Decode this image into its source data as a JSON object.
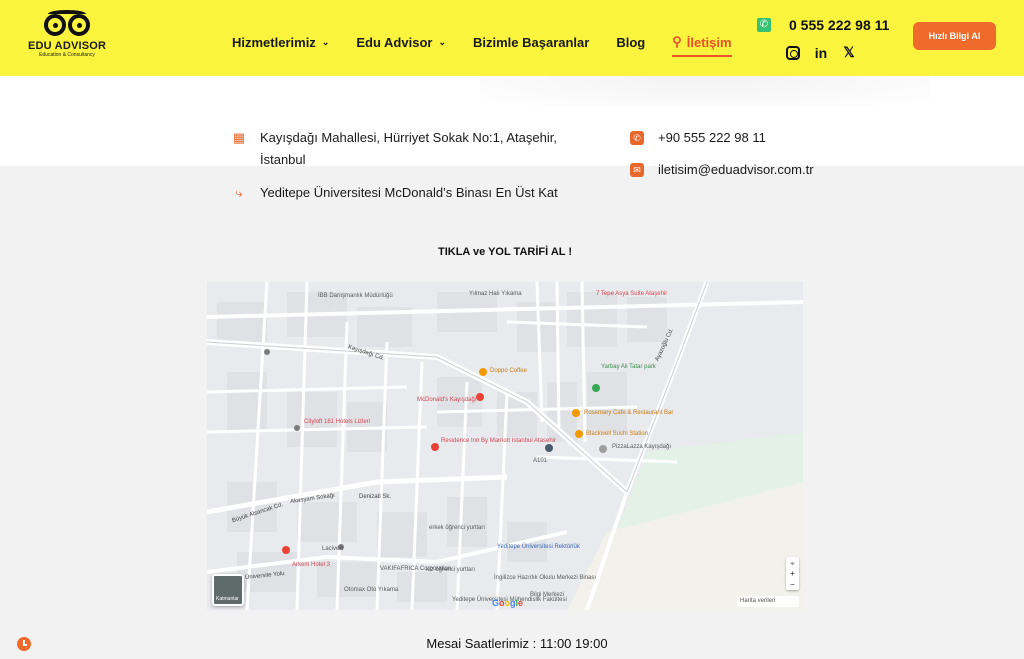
{
  "brand": {
    "name": "EDU ADVISOR",
    "tagline": "Education & Consultancy"
  },
  "nav": {
    "items": [
      {
        "label": "Hizmetlerimiz",
        "dropdown": true
      },
      {
        "label": "Edu Advisor",
        "dropdown": true
      },
      {
        "label": "Bizimle Başaranlar",
        "dropdown": false
      },
      {
        "label": "Blog",
        "dropdown": false
      },
      {
        "label": "İletişim",
        "dropdown": false,
        "active": true
      }
    ]
  },
  "header": {
    "phone": "0 555 222 98 11",
    "quick_button": "Hızlı Bilgi Al",
    "social": [
      "instagram-icon",
      "linkedin-icon",
      "x-icon"
    ]
  },
  "contact": {
    "address_line1": "Kayışdağı Mahallesi, Hürriyet Sokak No:1, Ataşehir,",
    "address_line2": "İstanbul",
    "directions": "Yeditepe Üniversitesi McDonald’s Binası En Üst Kat",
    "phone": "+90 555 222 98 11",
    "email": "iletisim@eduadvisor.com.tr"
  },
  "map_section": {
    "cta": "TIKLA ve YOL TARİFİ AL !",
    "labels": {
      "mcdonalds": "McDonald's Kayışdağı",
      "yeditepe": "Yeditepe Üniversitesi Rektörlük",
      "residence": "Residence Inn By Marriott Istanbul Atasehir",
      "pizza": "PizzaLazza Kayışdağı",
      "rosemary": "Rosemary Cafe & Restaurant Bar",
      "dopo": "Doppo Coffee",
      "blackwell": "Blackwell Sushi Station",
      "yarbay": "Yarbay Ali Tatar park",
      "ibb": "İBB Danışmanlık Müdürlüğü",
      "yilmaz": "Yılmaz Halı Yıkama",
      "tepe": "7 Tepe Asya Suite Ataşehir",
      "cityloft": "Cityloft 161 Hotels Lizleri",
      "arkem": "Arkem Hotel 3",
      "vakif": "VAKIFAFRICA Corporation",
      "otomax": "Otomax Oto Yıkama",
      "ingilizce": "İngilizce Hazırlık Okulu Merkezi Binası",
      "bilgi": "Bilgi Merkezi",
      "muhendislik": "Yeditepe Üniversitesi Mühendislik Fakültesi",
      "lacivert": "Lacivert",
      "erkek": "erkek öğrenci yurtları",
      "kiz": "kız öğrenci yurtları",
      "a101": "A101",
      "kayisdagi_cd": "Kayışdağı Cd.",
      "akasyam": "Akasyam Sokağı",
      "denizati": "Denizati Sk.",
      "universite": "Üniversite Yolu",
      "ayazoglu": "Ayazoğlu Cd.",
      "buyuk": "Büyük Alsancak Cd.",
      "layers": "Katmanlar",
      "attribution": "Harita verileri"
    }
  },
  "footer": {
    "hours_label": "Mesai Saatlerimiz : 11:00  19:00"
  }
}
